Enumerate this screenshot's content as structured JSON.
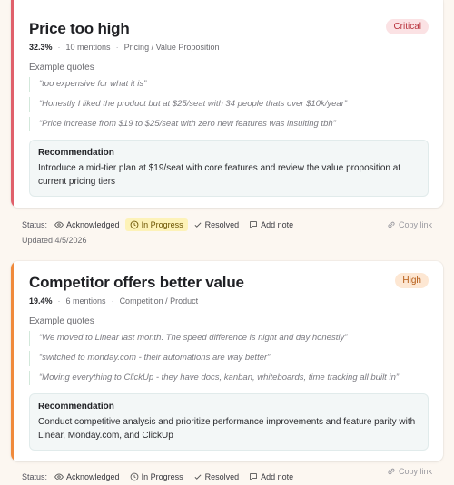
{
  "issues": [
    {
      "title": "Price too high",
      "severity": "Critical",
      "accent_color": "#e0606b",
      "badge_bg": "#fbe2e4",
      "badge_fg": "#b8323c",
      "percent": "32.3%",
      "mentions": "10 mentions",
      "category": "Pricing / Value Proposition",
      "quotes_label": "Example quotes",
      "quotes": [
        "“too expensive for what it is”",
        "“Honestly I liked the product but at $25/seat with 34 people thats over $10k/year”",
        "“Price increase from $19 to $25/seat with zero new features was insulting tbh”"
      ],
      "recommendation_label": "Recommendation",
      "recommendation": "Introduce a mid-tier plan at $19/seat with core features and review the value proposition at current pricing tiers",
      "status_label": "Status:",
      "statuses": {
        "acknowledged": "Acknowledged",
        "in_progress": "In Progress",
        "resolved": "Resolved",
        "add_note": "Add note"
      },
      "active_status": "In Progress",
      "copy_link": "Copy link",
      "updated": "Updated 4/5/2026"
    },
    {
      "title": "Competitor offers better value",
      "severity": "High",
      "accent_color": "#f08a3c",
      "badge_bg": "#fde7d3",
      "badge_fg": "#b45a14",
      "percent": "19.4%",
      "mentions": "6 mentions",
      "category": "Competition / Product",
      "quotes_label": "Example quotes",
      "quotes": [
        "“We moved to Linear last month. The speed difference is night and day honestly”",
        "“switched to monday.com - their automations are way better”",
        "“Moving everything to ClickUp - they have docs, kanban, whiteboards, time tracking all built in”"
      ],
      "recommendation_label": "Recommendation",
      "recommendation": "Conduct competitive analysis and prioritize performance improvements and feature parity with Linear, Monday.com, and ClickUp",
      "status_label": "Status:",
      "statuses": {
        "acknowledged": "Acknowledged",
        "in_progress": "In Progress",
        "resolved": "Resolved",
        "add_note": "Add note"
      },
      "active_status": "",
      "copy_link": "Copy link"
    }
  ]
}
